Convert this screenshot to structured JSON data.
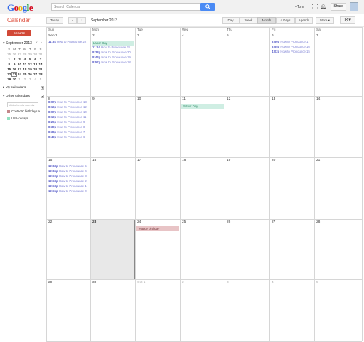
{
  "topbar": {
    "logo": "Google",
    "search_placeholder": "Search Calendar",
    "search_icon": "search-icon",
    "user": "+Tom",
    "share_label": "Share"
  },
  "toolbar": {
    "app_name": "Calendar",
    "today": "Today",
    "prev": "‹",
    "next": "›",
    "date_range": "September 2013",
    "views": [
      "Day",
      "Week",
      "Month",
      "4 Days",
      "Agenda"
    ],
    "selected_view": "Month",
    "more": "More ▾",
    "settings_icon": "gear-icon"
  },
  "sidebar": {
    "create_label": "CREATE",
    "mini_title": "September 2013",
    "mini_prev": "‹",
    "mini_next": "›",
    "mini_head": [
      "S",
      "M",
      "T",
      "W",
      "T",
      "F",
      "S"
    ],
    "mini_weeks": [
      [
        "25",
        "26",
        "27",
        "28",
        "29",
        "30",
        "31"
      ],
      [
        "1",
        "2",
        "3",
        "4",
        "5",
        "6",
        "7"
      ],
      [
        "8",
        "9",
        "10",
        "11",
        "12",
        "13",
        "14"
      ],
      [
        "15",
        "16",
        "17",
        "18",
        "19",
        "20",
        "21"
      ],
      [
        "22",
        "23",
        "24",
        "25",
        "26",
        "27",
        "28"
      ],
      [
        "29",
        "30",
        "1",
        "2",
        "3",
        "4",
        "5"
      ]
    ],
    "my_calendars": "My calendars",
    "other_calendars": "Other calendars",
    "add_placeholder": "Add a friend's calendar",
    "calendars": [
      {
        "label": "Contacts' birthdays a...",
        "color": "#c4878a"
      },
      {
        "label": "US Holidays",
        "color": "#92e1c0"
      }
    ]
  },
  "calendar": {
    "days_of_week": [
      "Sun",
      "Mon",
      "Tue",
      "Wed",
      "Thu",
      "Fri",
      "Sat"
    ],
    "weeks": [
      {
        "days": [
          "Sep 1",
          "2",
          "3",
          "4",
          "5",
          "6",
          "7"
        ]
      },
      {
        "days": [
          "8",
          "9",
          "10",
          "11",
          "12",
          "13",
          "14"
        ]
      },
      {
        "days": [
          "15",
          "16",
          "17",
          "18",
          "19",
          "20",
          "21"
        ]
      },
      {
        "days": [
          "22",
          "23",
          "24",
          "25",
          "26",
          "27",
          "28"
        ]
      },
      {
        "days": [
          "29",
          "30",
          "Oct 1",
          "2",
          "3",
          "4",
          "5"
        ]
      }
    ],
    "allday": [
      {
        "label": "Labor Day",
        "color": "#cfeee3",
        "text": "#2a8a65"
      },
      {
        "label": "Patriot Day",
        "color": "#cfeee3",
        "text": "#2a8a65"
      },
      {
        "label": "\"Happy birthday\"",
        "color": "#e8c4c6",
        "text": "#7a3a3f"
      }
    ],
    "events": [
      {
        "time": "11:34",
        "title": "How to Pronounce 22"
      },
      {
        "time": "11:24",
        "title": "How to Pronounce 21"
      },
      {
        "time": "8:38p",
        "title": "How to Pronounce 20"
      },
      {
        "time": "8:43p",
        "title": "How to Pronounce 19"
      },
      {
        "time": "8:57p",
        "title": "How to Pronounce 18"
      },
      {
        "time": "3:50p",
        "title": "How to Pronounce 17"
      },
      {
        "time": "3:55p",
        "title": "How to Pronounce 16"
      },
      {
        "time": "4:02p",
        "title": "How to Pronounce 15"
      },
      {
        "time": "8:07p",
        "title": "How to Pronounce 13"
      },
      {
        "time": "8:16p",
        "title": "How to Pronounce 12"
      },
      {
        "time": "8:07p",
        "title": "How to Pronounce 10"
      },
      {
        "time": "8:19p",
        "title": "How to Pronounce 11"
      },
      {
        "time": "8:26p",
        "title": "How to Pronounce 9"
      },
      {
        "time": "8:30p",
        "title": "How to Pronounce 8"
      },
      {
        "time": "8:34p",
        "title": "How to Pronounce 7"
      },
      {
        "time": "8:42p",
        "title": "How to Pronounce 6"
      },
      {
        "time": "12:43p",
        "title": "How to Pronounce 5"
      },
      {
        "time": "12:46p",
        "title": "How to Pronounce 4"
      },
      {
        "time": "12:50p",
        "title": "How to Pronounce 3"
      },
      {
        "time": "12:53p",
        "title": "How to Pronounce 2"
      },
      {
        "time": "12:53p",
        "title": "How to Pronounce 1"
      },
      {
        "time": "12:55p",
        "title": "How to Pronounce 0"
      }
    ]
  }
}
